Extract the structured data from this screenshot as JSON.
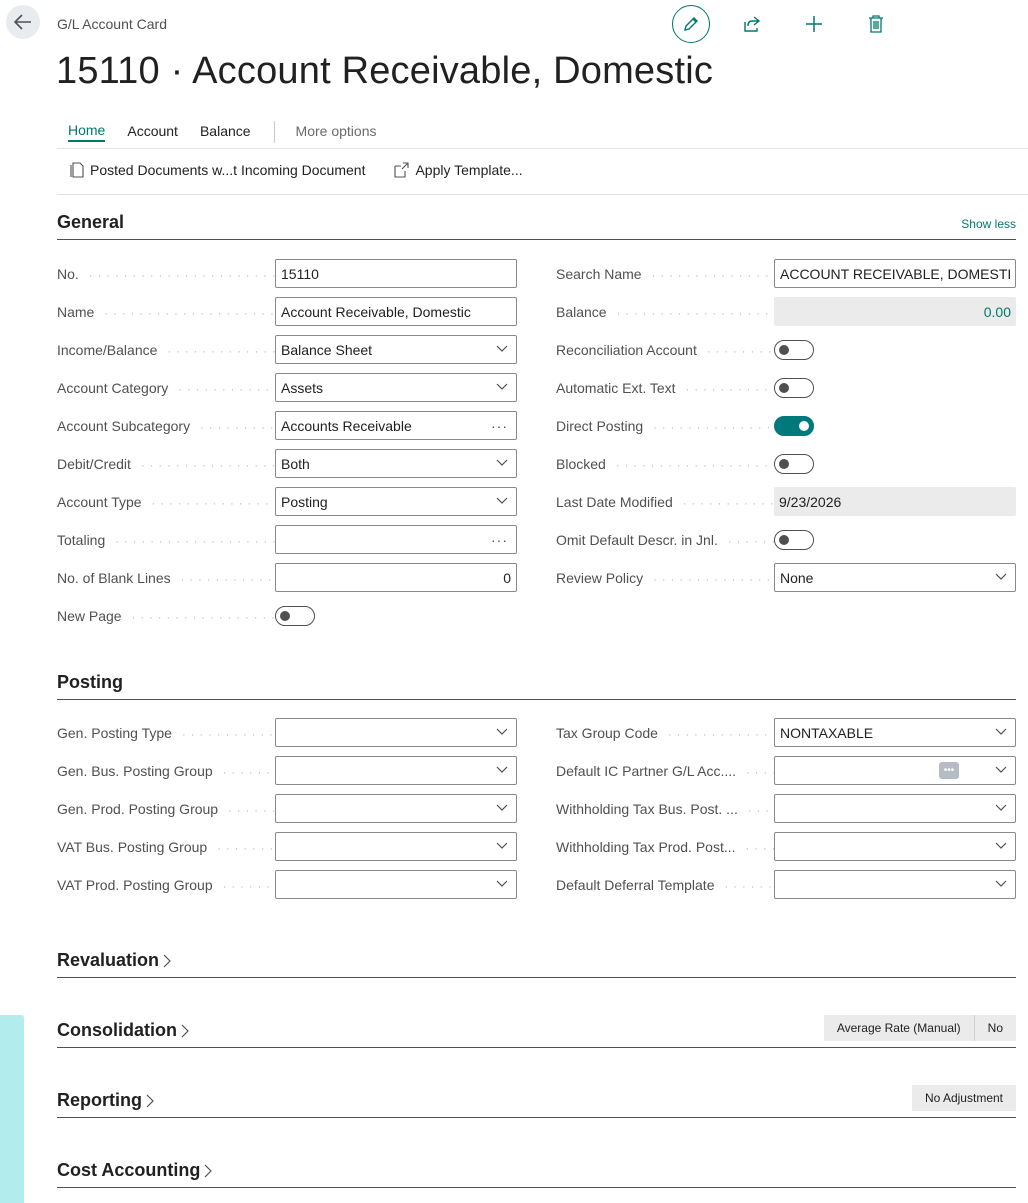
{
  "header": {
    "breadcrumb": "G/L Account Card",
    "title": "15110 · Account Receivable, Domestic",
    "actions": [
      "edit-icon",
      "share-icon",
      "new-icon",
      "delete-icon"
    ]
  },
  "tabs": [
    {
      "label": "Home",
      "active": true
    },
    {
      "label": "Account"
    },
    {
      "label": "Balance"
    },
    {
      "label": "More options"
    }
  ],
  "subactions": [
    {
      "label": "Posted Documents w...t Incoming Document",
      "icon": "document-icon"
    },
    {
      "label": "Apply Template...",
      "icon": "template-icon"
    }
  ],
  "general": {
    "title": "General",
    "show_less": "Show less",
    "left": [
      {
        "label": "No.",
        "value": "15110",
        "kind": "text"
      },
      {
        "label": "Name",
        "value": "Account Receivable, Domestic",
        "kind": "text"
      },
      {
        "label": "Income/Balance",
        "value": "Balance Sheet",
        "kind": "dropdown"
      },
      {
        "label": "Account Category",
        "value": "Assets",
        "kind": "dropdown"
      },
      {
        "label": "Account Subcategory",
        "value": "Accounts Receivable",
        "kind": "lookup"
      },
      {
        "label": "Debit/Credit",
        "value": "Both",
        "kind": "dropdown"
      },
      {
        "label": "Account Type",
        "value": "Posting",
        "kind": "dropdown"
      },
      {
        "label": "Totaling",
        "value": "",
        "kind": "lookup"
      },
      {
        "label": "No. of Blank Lines",
        "value": "0",
        "kind": "number"
      },
      {
        "label": "New Page",
        "value": false,
        "kind": "toggle"
      }
    ],
    "right": [
      {
        "label": "Search Name",
        "value": "ACCOUNT RECEIVABLE, DOMESTIC",
        "kind": "text"
      },
      {
        "label": "Balance",
        "value": "0.00",
        "kind": "readonly-number"
      },
      {
        "label": "Reconciliation Account",
        "value": false,
        "kind": "toggle"
      },
      {
        "label": "Automatic Ext. Text",
        "value": false,
        "kind": "toggle"
      },
      {
        "label": "Direct Posting",
        "value": true,
        "kind": "toggle"
      },
      {
        "label": "Blocked",
        "value": false,
        "kind": "toggle"
      },
      {
        "label": "Last Date Modified",
        "value": "9/23/2026",
        "kind": "readonly"
      },
      {
        "label": "Omit Default Descr. in Jnl.",
        "value": false,
        "kind": "toggle"
      },
      {
        "label": "Review Policy",
        "value": "None",
        "kind": "dropdown"
      }
    ]
  },
  "posting": {
    "title": "Posting",
    "left": [
      {
        "label": "Gen. Posting Type",
        "value": "",
        "kind": "dropdown"
      },
      {
        "label": "Gen. Bus. Posting Group",
        "value": "",
        "kind": "dropdown"
      },
      {
        "label": "Gen. Prod. Posting Group",
        "value": "",
        "kind": "dropdown"
      },
      {
        "label": "VAT Bus. Posting Group",
        "value": "",
        "kind": "dropdown"
      },
      {
        "label": "VAT Prod. Posting Group",
        "value": "",
        "kind": "dropdown"
      }
    ],
    "right": [
      {
        "label": "Tax Group Code",
        "value": "NONTAXABLE",
        "kind": "dropdown"
      },
      {
        "label": "Default IC Partner G/L Acc....",
        "value": "",
        "kind": "dropdown-lookup"
      },
      {
        "label": "Withholding Tax Bus. Post. ...",
        "value": "",
        "kind": "dropdown"
      },
      {
        "label": "Withholding Tax Prod. Post...",
        "value": "",
        "kind": "dropdown"
      },
      {
        "label": "Default Deferral Template",
        "value": "",
        "kind": "dropdown"
      }
    ]
  },
  "collapsed": [
    {
      "title": "Revaluation",
      "summary": []
    },
    {
      "title": "Consolidation",
      "summary": [
        "Average Rate (Manual)",
        "No"
      ]
    },
    {
      "title": "Reporting",
      "summary": [
        "No Adjustment"
      ]
    },
    {
      "title": "Cost Accounting",
      "summary": []
    }
  ],
  "colors": {
    "accent": "#00796b",
    "toggle_on": "#00797d"
  }
}
